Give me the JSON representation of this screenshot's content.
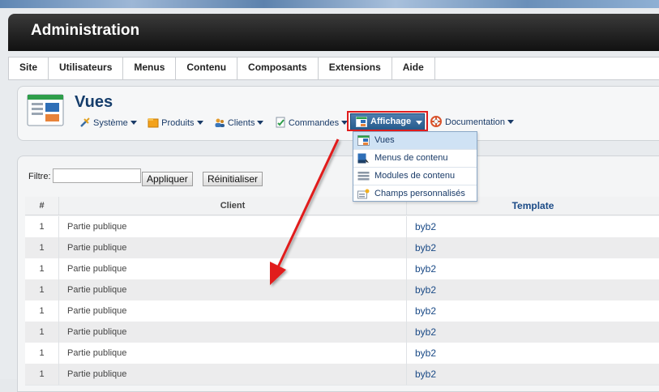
{
  "header": {
    "title": "Administration"
  },
  "menubar": {
    "items": [
      "Site",
      "Utilisateurs",
      "Menus",
      "Contenu",
      "Composants",
      "Extensions",
      "Aide"
    ]
  },
  "page": {
    "title": "Vues"
  },
  "submenu": {
    "items": [
      {
        "label": "Système",
        "icon": "tools-icon"
      },
      {
        "label": "Produits",
        "icon": "folder-icon"
      },
      {
        "label": "Clients",
        "icon": "users-icon"
      },
      {
        "label": "Commandes",
        "icon": "orders-icon"
      }
    ],
    "active": {
      "label": "Affichage",
      "icon": "display-icon"
    },
    "after": {
      "label": "Documentation",
      "icon": "lifebuoy-icon"
    }
  },
  "dropdown": {
    "items": [
      {
        "label": "Vues",
        "icon": "views-icon",
        "selected": true
      },
      {
        "label": "Menus de contenu",
        "icon": "content-menu-icon",
        "selected": false
      },
      {
        "label": "Modules de contenu",
        "icon": "modules-icon",
        "selected": false
      },
      {
        "label": "Champs personnalisés",
        "icon": "custom-fields-icon",
        "selected": false
      }
    ]
  },
  "filter": {
    "label": "Filtre:",
    "value": "",
    "apply_label": "Appliquer",
    "reset_label": "Réinitialiser"
  },
  "table": {
    "headers": [
      "#",
      "Client",
      "Template"
    ],
    "rows": [
      [
        "1",
        "Partie publique",
        "byb2"
      ],
      [
        "1",
        "Partie publique",
        "byb2"
      ],
      [
        "1",
        "Partie publique",
        "byb2"
      ],
      [
        "1",
        "Partie publique",
        "byb2"
      ],
      [
        "1",
        "Partie publique",
        "byb2"
      ],
      [
        "1",
        "Partie publique",
        "byb2"
      ],
      [
        "1",
        "Partie publique",
        "byb2"
      ],
      [
        "1",
        "Partie publique",
        "byb2"
      ]
    ]
  },
  "colors": {
    "accent": "#255a8c",
    "highlight": "#e01d1d",
    "link": "#1a4a86"
  }
}
